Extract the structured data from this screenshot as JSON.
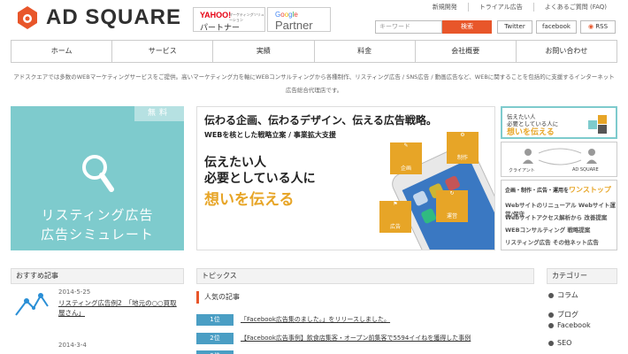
{
  "brand": {
    "name": "AD SQUARE",
    "accent": "#e8562a",
    "teal": "#7ecbcd",
    "gold": "#e7a527"
  },
  "badges": {
    "yahoo_logo": "YAHOO!",
    "yahoo_sub": "マーケティングソリューション",
    "yahoo_label": "パートナー",
    "google_logo": "Google",
    "google_label": "Partner"
  },
  "top_links": [
    "新規開発",
    "トライアル広告",
    "よくあるご質問 (FAQ)"
  ],
  "search": {
    "placeholder": "キーワード",
    "button": "検索"
  },
  "sns": [
    "Twitter",
    "facebook",
    "RSS"
  ],
  "nav": [
    "ホーム",
    "サービス",
    "実績",
    "料金",
    "会社概要",
    "お問い合わせ"
  ],
  "intro": "アドスクエアでは多数のWEBマーケティングサービスをご提供。高いマーケティング力を軸にWEBコンサルティングから各種制作、リスティング広告 / SNS広告 / 動画広告など、WEBに関することを包括的に支援するインターネット広告総合代理店です。",
  "simulator": {
    "badge": "無料",
    "line1": "リスティング広告",
    "line2": "広告シミュレート"
  },
  "banner": {
    "headline": "伝わる企画、伝わるデザイン、伝える広告戦略。",
    "sub": "WEBを核とした戦略立案 / 事業拡大支援",
    "line1": "伝えたい人",
    "line2": "必要としている人に",
    "highlight": "想いを伝える",
    "icons": [
      "企画",
      "制作",
      "広告",
      "運営"
    ]
  },
  "side": {
    "s1_line1": "伝えたい人",
    "s1_line1b": "必要としている人に",
    "s1_line2": "想いを伝える",
    "s2_client": "クライアント",
    "s2_brand": "AD SQUARE",
    "s3_top": "企画・制作・広告・運用を",
    "s3_top_b": "ワンストップ",
    "s3_rows": [
      "Webサイトのリニューアル Webサイト運営/保守",
      "Webサイトアクセス解析から 改善提案",
      "WEBコンサルティング 戦略提案",
      "リスティング広告 その他ネット広告"
    ]
  },
  "recommended": {
    "title": "おすすめ記事",
    "items": [
      {
        "date": "2014-5-25",
        "title": "リスティング広告例2　「地元の○○買取屋さん」"
      },
      {
        "date": "2014-3-4",
        "title": ""
      }
    ]
  },
  "topics": {
    "title": "トピックス",
    "popular": "人気の記事",
    "ranks": [
      {
        "rank": "1位",
        "text": "「Facebook広告集のました。」をリリースしました。"
      },
      {
        "rank": "2位",
        "text": "【Facebook広告事例】飲食店集客・オープン前集客で5594イイねを獲得した事例"
      },
      {
        "rank": "3位",
        "text": ""
      }
    ]
  },
  "categories": {
    "title": "カテゴリー",
    "items": [
      "コラム",
      "ブログ",
      "Facebook",
      "SEO"
    ]
  }
}
